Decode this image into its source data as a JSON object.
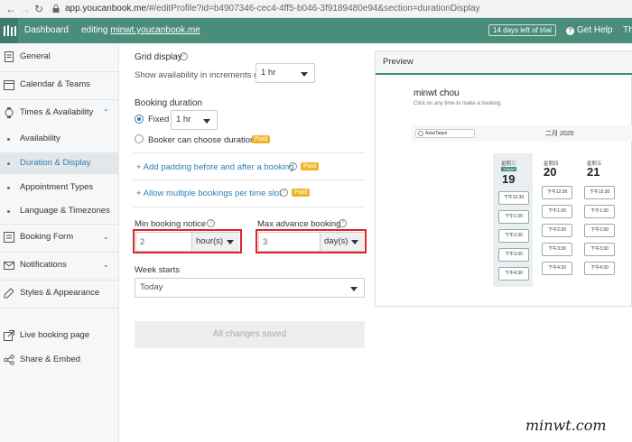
{
  "browser": {
    "url_host": "app.youcanbook.me",
    "url_path": "/#/editProfile?id=b4907346-cec4-4ff5-b046-3f9189480e94&section=durationDisplay"
  },
  "appbar": {
    "dashboard": "Dashboard",
    "editing_prefix": "editing",
    "editing_site": "minwt.youcanbook.me",
    "trial": "14 days left of trial",
    "help": "Get Help",
    "user": "Th"
  },
  "sidebar": {
    "items": [
      {
        "label": "General",
        "icon": "document-icon"
      },
      {
        "label": "Calendar & Teams",
        "icon": "calendar-icon"
      },
      {
        "label": "Times & Availability",
        "icon": "watch-icon"
      },
      {
        "label": "Booking Form",
        "icon": "form-icon"
      },
      {
        "label": "Notifications",
        "icon": "envelope-icon"
      },
      {
        "label": "Styles & Appearance",
        "icon": "palette-icon"
      },
      {
        "label": "Live booking page",
        "icon": "external-link-icon"
      },
      {
        "label": "Share & Embed",
        "icon": "share-icon"
      }
    ],
    "sub_items": [
      "Availability",
      "Duration & Display",
      "Appointment Types",
      "Language & Timezones"
    ],
    "active_sub": "Duration & Display"
  },
  "main": {
    "grid_title": "Grid display",
    "grid_label": "Show availability in increments of",
    "grid_value": "1 hr",
    "duration_title": "Booking duration",
    "fixed_label": "Fixed",
    "fixed_value": "1 hr",
    "booker_label": "Booker can choose duration",
    "paid": "Paid",
    "padding_link": "+ Add padding before and after a booking",
    "multiple_link": "+ Allow multiple bookings per time slot",
    "min_notice_label": "Min booking notice",
    "min_notice_value": "2",
    "min_notice_unit": "hour(s)",
    "max_adv_label": "Max advance booking",
    "max_adv_value": "3",
    "max_adv_unit": "day(s)",
    "week_label": "Week starts",
    "week_value": "Today",
    "save": "All changes saved"
  },
  "preview": {
    "title": "Preview",
    "name": "minwt chou",
    "subtitle": "Click on any time to make a booking.",
    "timezone": "Asia/Taipei",
    "month": "二月 2020",
    "days": [
      {
        "name": "星期三",
        "date": "19",
        "today": "TODAY",
        "slots": [
          "下午12:30",
          "下午1:30",
          "下午2:30",
          "下午3:30",
          "下午4:30"
        ]
      },
      {
        "name": "星期四",
        "date": "20",
        "slots": [
          "下午12:30",
          "下午1:30",
          "下午2:30",
          "下午3:30",
          "下午4:30"
        ]
      },
      {
        "name": "星期五",
        "date": "21",
        "slots": [
          "下午12:30",
          "下午1:30",
          "下午2:30",
          "下午3:30",
          "下午4:30"
        ]
      }
    ]
  },
  "watermark": "minwt.com",
  "colors": {
    "accent": "#4a8d7a",
    "link": "#2e7fb8",
    "highlight": "#d9262e",
    "paid": "#f0b429"
  }
}
